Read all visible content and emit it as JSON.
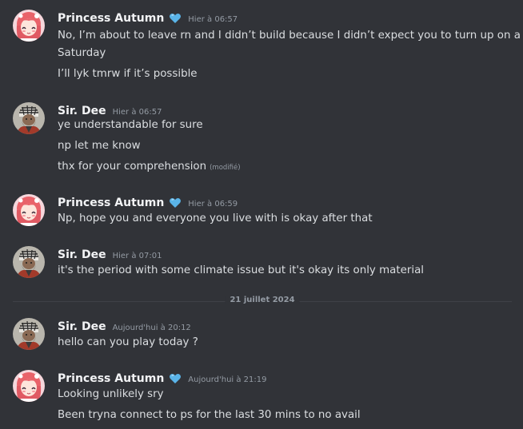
{
  "messages": [
    {
      "author": "Princess Autumn",
      "avatar_icon": "anime-girl-avatar",
      "badge_icon": "heart-icon",
      "badge_color": "#5ab4e8",
      "timestamp": "Hier à 06:57",
      "lines": [
        "No, I’m about to leave rn and I didn’t build because I didn’t expect you to turn up on a Saturday",
        "I’ll lyk tmrw if it’s possible"
      ]
    },
    {
      "author": "Sir. Dee",
      "avatar_icon": "bearded-man-avatar",
      "timestamp": "Hier à 06:57",
      "lines": [
        "ye understandable for sure",
        "np let me know",
        "thx for your comprehension"
      ],
      "edited_label": "(modifié)"
    },
    {
      "author": "Princess Autumn",
      "badge_icon": "heart-icon",
      "timestamp": "Hier à 06:59",
      "lines": [
        "Np, hope you and everyone you live with is okay after that"
      ]
    },
    {
      "author": "Sir. Dee",
      "timestamp": "Hier à 07:01",
      "lines": [
        "it's the period with some climate issue but it's okay its only material"
      ]
    },
    {
      "author": "Sir. Dee",
      "timestamp": "Aujourd'hui à 20:12",
      "lines": [
        "hello can you play today ?"
      ]
    },
    {
      "author": "Princess Autumn",
      "badge_icon": "heart-icon",
      "timestamp": "Aujourd'hui à 21:19",
      "lines": [
        "Looking unlikely sry",
        "Been tryna connect to ps for the last 30 mins to no avail"
      ]
    }
  ],
  "date_divider": "21 juillet 2024",
  "colors": {
    "background": "#313338",
    "username": "#f2f3f5",
    "text": "#dbdee1",
    "muted": "#949ba4",
    "divider": "#3f4147"
  }
}
